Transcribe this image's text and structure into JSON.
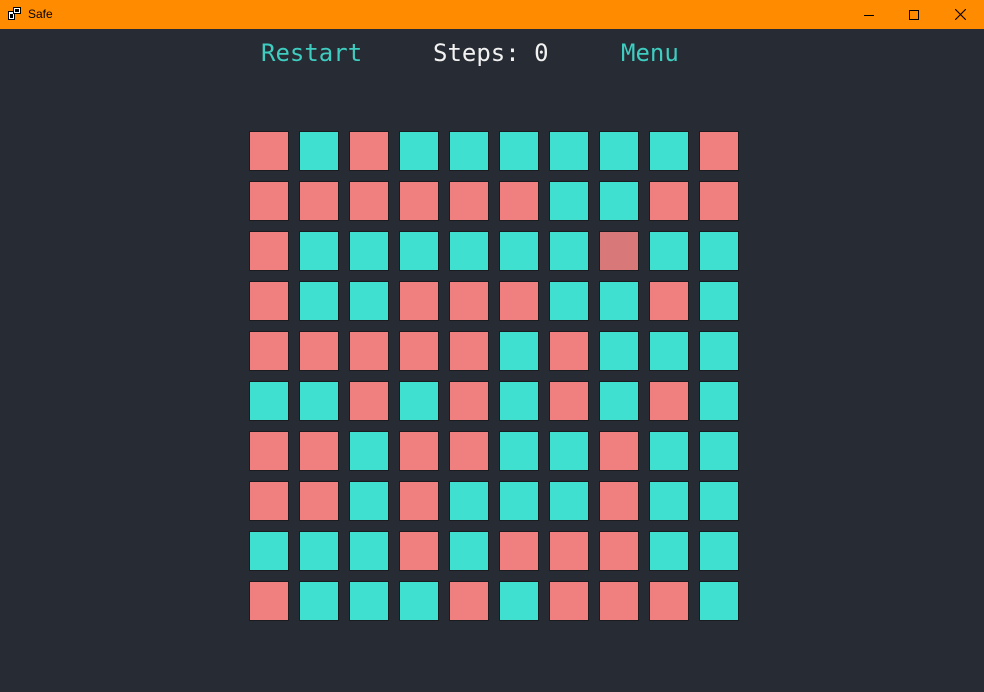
{
  "window": {
    "title": "Safe",
    "titlebar_color": "#ff8c00",
    "background_color": "#272b33",
    "controls": [
      "minimize-icon",
      "maximize-icon",
      "close-icon"
    ]
  },
  "topbar": {
    "restart_label": "Restart",
    "steps_label": "Steps:",
    "steps_value": "0",
    "menu_label": "Menu"
  },
  "board": {
    "colors": {
      "R": "#f08080",
      "T": "#40e0d0",
      "D": "#d87878"
    },
    "rows": [
      [
        "R",
        "T",
        "R",
        "T",
        "T",
        "T",
        "T",
        "T",
        "T",
        "R"
      ],
      [
        "R",
        "R",
        "R",
        "R",
        "R",
        "R",
        "T",
        "T",
        "R",
        "R"
      ],
      [
        "R",
        "T",
        "T",
        "T",
        "T",
        "T",
        "T",
        "D",
        "T",
        "T"
      ],
      [
        "R",
        "T",
        "T",
        "R",
        "R",
        "R",
        "T",
        "T",
        "R",
        "T"
      ],
      [
        "R",
        "R",
        "R",
        "R",
        "R",
        "T",
        "R",
        "T",
        "T",
        "T"
      ],
      [
        "T",
        "T",
        "R",
        "T",
        "R",
        "T",
        "R",
        "T",
        "R",
        "T"
      ],
      [
        "R",
        "R",
        "T",
        "R",
        "R",
        "T",
        "T",
        "R",
        "T",
        "T"
      ],
      [
        "R",
        "R",
        "T",
        "R",
        "T",
        "T",
        "T",
        "R",
        "T",
        "T"
      ],
      [
        "T",
        "T",
        "T",
        "R",
        "T",
        "R",
        "R",
        "R",
        "T",
        "T"
      ],
      [
        "R",
        "T",
        "T",
        "T",
        "R",
        "T",
        "R",
        "R",
        "R",
        "T"
      ]
    ]
  }
}
